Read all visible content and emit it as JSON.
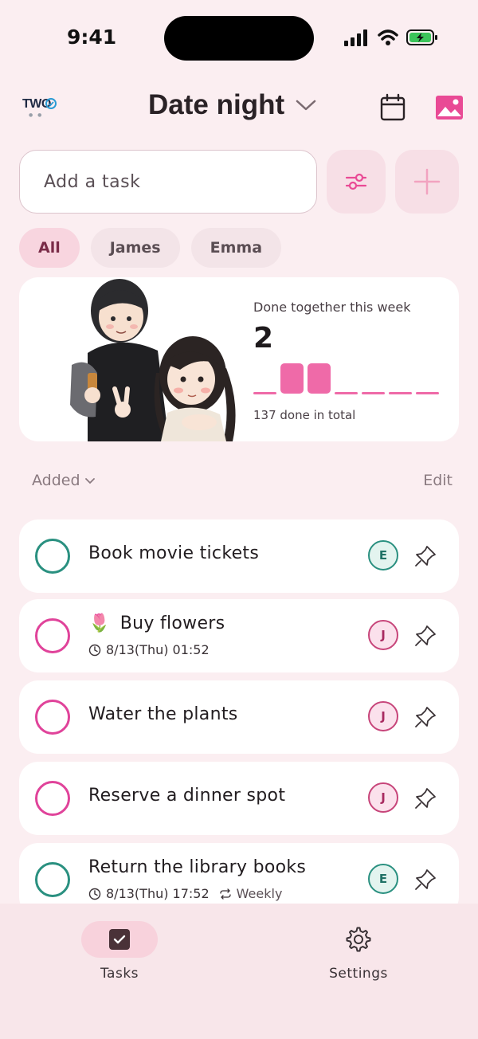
{
  "status_bar": {
    "time": "9:41"
  },
  "header": {
    "logo": "TWO",
    "list_title": "Date night"
  },
  "add_task": {
    "placeholder": "Add a task"
  },
  "filters": {
    "chips": [
      "All",
      "James",
      "Emma"
    ],
    "active": "All"
  },
  "stats": {
    "title": "Done together this week",
    "count": "2",
    "weekly_done": [
      0,
      1,
      1,
      0,
      0,
      0,
      0
    ],
    "total": "137 done in total"
  },
  "list_controls": {
    "sort_label": "Added",
    "edit_label": "Edit"
  },
  "tasks": [
    {
      "title": "Book movie tickets",
      "emoji": "",
      "due": "",
      "repeat": "",
      "assignee": "E",
      "color": "#2a9080"
    },
    {
      "title": "Buy flowers",
      "emoji": "🌷",
      "due": "8/13(Thu) 01:52",
      "repeat": "",
      "assignee": "J",
      "color": "#e0439a"
    },
    {
      "title": "Water the plants",
      "emoji": "",
      "due": "",
      "repeat": "",
      "assignee": "J",
      "color": "#e0439a"
    },
    {
      "title": "Reserve a dinner spot",
      "emoji": "",
      "due": "",
      "repeat": "",
      "assignee": "J",
      "color": "#e0439a"
    },
    {
      "title": "Return the library books",
      "emoji": "",
      "due": "8/13(Thu) 17:52",
      "repeat": "Weekly",
      "assignee": "E",
      "color": "#2a9080"
    }
  ],
  "tab_bar": {
    "tasks_label": "Tasks",
    "settings_label": "Settings",
    "active": "Tasks"
  },
  "colors": {
    "accent": "#e0439a",
    "bar_fill": "#ef6aa8",
    "teal": "#2a9080",
    "background": "#fbeef1"
  }
}
